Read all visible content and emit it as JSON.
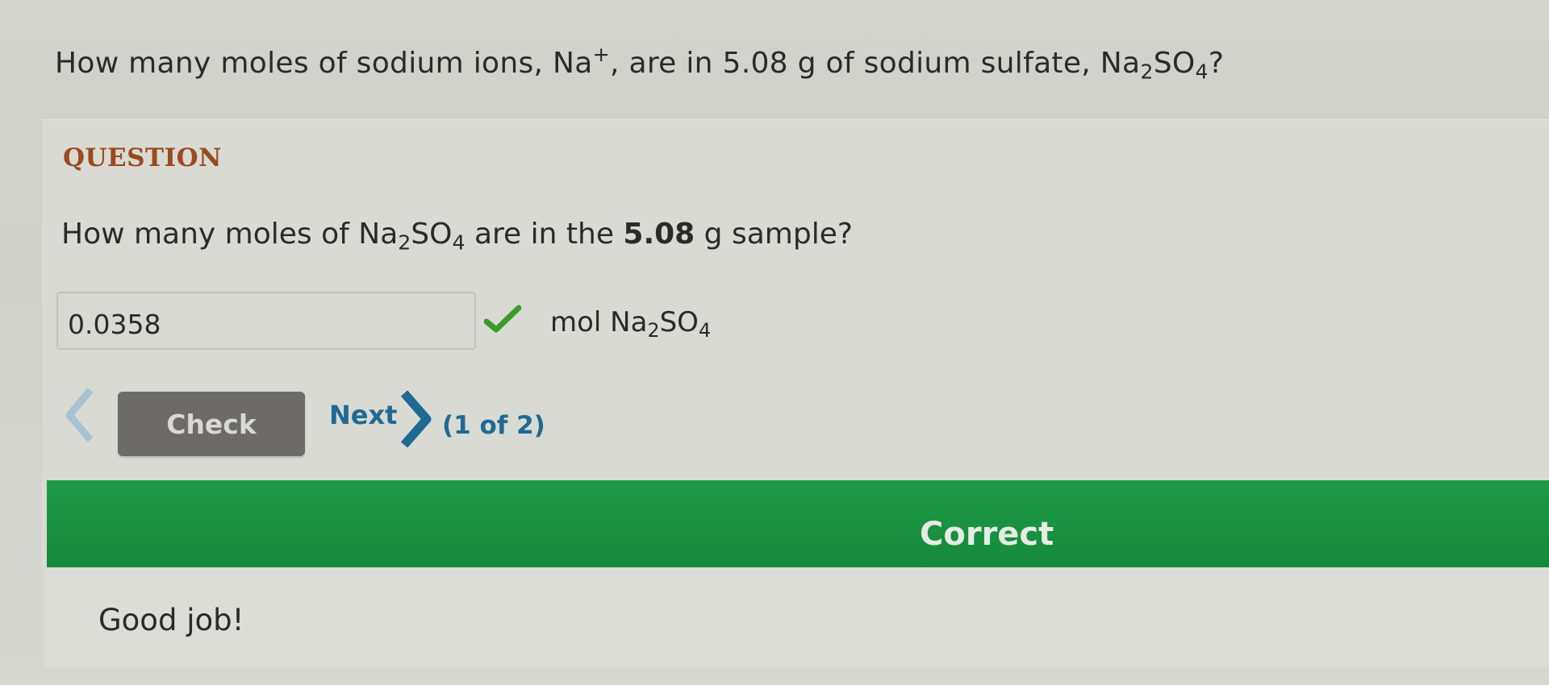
{
  "main_question": {
    "lead": "How many moles of sodium ions, Na",
    "ion_charge": "+",
    "middle": ", are in 5.08 g of sodium sulfate, Na",
    "sub1": "2",
    "so": "SO",
    "sub2": "4",
    "end": "?"
  },
  "section_label": "QUESTION",
  "sub_question": {
    "lead": "How many moles of Na",
    "sub1": "2",
    "so": "SO",
    "sub2": "4",
    "middle": " are in the ",
    "mass": "5.08",
    "end": " g sample?"
  },
  "answer": {
    "value": "0.0358",
    "status": "correct",
    "check_icon": "check-mark-icon",
    "check_color": "#3e9a2a"
  },
  "unit": {
    "mol": "mol Na",
    "sub1": "2",
    "so": "SO",
    "sub2": "4"
  },
  "navigation": {
    "prev_icon": "chevron-left-icon",
    "check_label": "Check",
    "next_label": "Next",
    "next_icon": "chevron-right-icon",
    "page_count": "(1 of 2)"
  },
  "feedback": {
    "title": "Correct",
    "message": "Good job!",
    "banner_color": "#1a9240"
  },
  "colors": {
    "section_label": "#9a4a1c",
    "link": "#1f6a93",
    "check_button": "#6c6b68"
  }
}
